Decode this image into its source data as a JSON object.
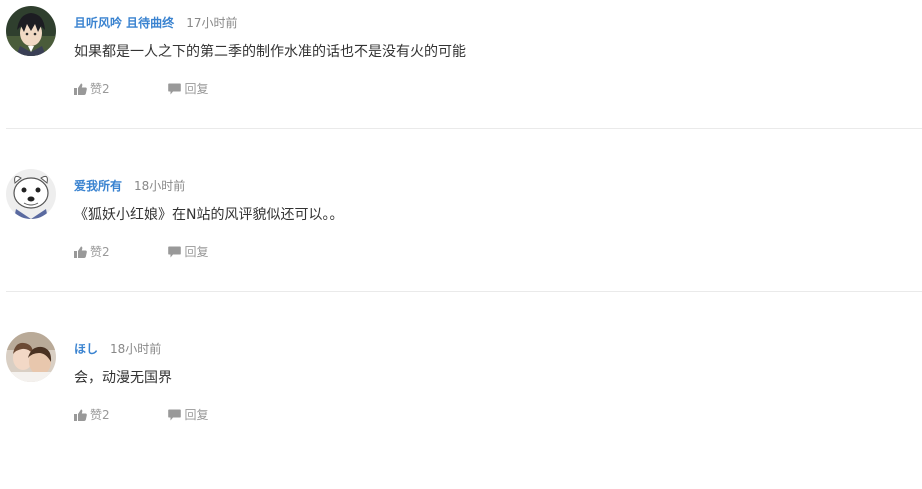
{
  "colors": {
    "username": "#3a83d0",
    "time": "#888888",
    "content": "#333333",
    "action": "#999999",
    "divider": "#eaeaea"
  },
  "comments": [
    {
      "username": "且听风吟 且待曲终",
      "time": "17小时前",
      "content": "如果都是一人之下的第二季的制作水准的话也不是没有火的可能",
      "like_label": "赞2",
      "reply_label": "回复",
      "avatar_icon": "anime-boy-avatar"
    },
    {
      "username": "爱我所有",
      "time": "18小时前",
      "content": "《狐妖小红娘》在N站的风评貌似还可以。。",
      "like_label": "赞2",
      "reply_label": "回复",
      "avatar_icon": "white-dog-avatar"
    },
    {
      "username": "ほし",
      "time": "18小时前",
      "content": "会，动漫无国界",
      "like_label": "赞2",
      "reply_label": "回复",
      "avatar_icon": "photo-avatar"
    }
  ]
}
